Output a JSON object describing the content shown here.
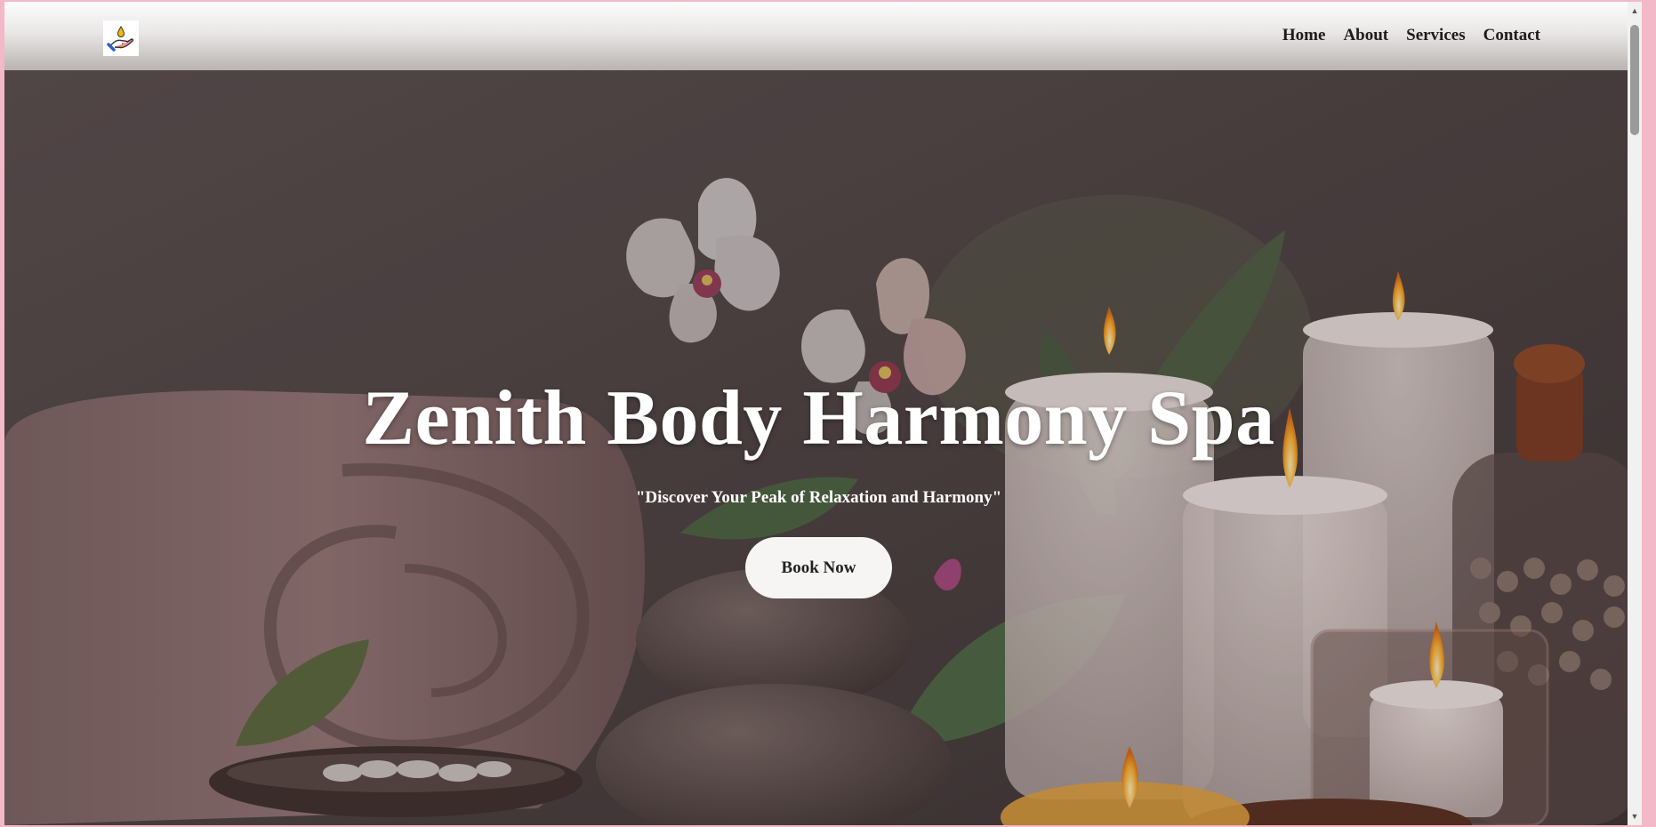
{
  "header": {
    "logo_icon": "hand-holding-drop-icon",
    "nav": [
      {
        "label": "Home"
      },
      {
        "label": "About"
      },
      {
        "label": "Services"
      },
      {
        "label": "Contact"
      }
    ]
  },
  "hero": {
    "title": "Zenith Body Harmony Spa",
    "tagline": "\"Discover Your Peak of Relaxation and Harmony\"",
    "cta_label": "Book Now",
    "background": "spa-still-life-image"
  },
  "colors": {
    "nav_gradient_top": "#fdfdfd",
    "nav_gradient_bottom": "#b9b4b1",
    "button_bg": "#f6f5f4",
    "page_border": "#f3b9c9"
  }
}
